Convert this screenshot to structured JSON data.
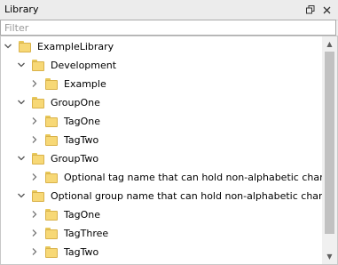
{
  "panel": {
    "title": "Library",
    "float_icon": "restore-icon",
    "close_icon": "close-icon"
  },
  "filter": {
    "placeholder": "Filter",
    "value": ""
  },
  "tree": {
    "rows": [
      {
        "label": "ExampleLibrary",
        "expanded": true
      },
      {
        "label": "Development",
        "expanded": true
      },
      {
        "label": "Example",
        "expanded": false
      },
      {
        "label": "GroupOne",
        "expanded": true
      },
      {
        "label": "TagOne",
        "expanded": false
      },
      {
        "label": "TagTwo",
        "expanded": false
      },
      {
        "label": "GroupTwo",
        "expanded": true
      },
      {
        "label": "Optional tag name that can hold non-alphabetic characters",
        "expanded": false
      },
      {
        "label": "Optional group name that can hold non-alphabetic characters",
        "expanded": true
      },
      {
        "label": "TagOne",
        "expanded": false
      },
      {
        "label": "TagThree",
        "expanded": false
      },
      {
        "label": "TagTwo",
        "expanded": false
      }
    ]
  },
  "colors": {
    "folder_fill": "#f7d876",
    "folder_border": "#d9b24a",
    "tree_background": "#ffffff",
    "chrome_background": "#f0f0f0"
  }
}
